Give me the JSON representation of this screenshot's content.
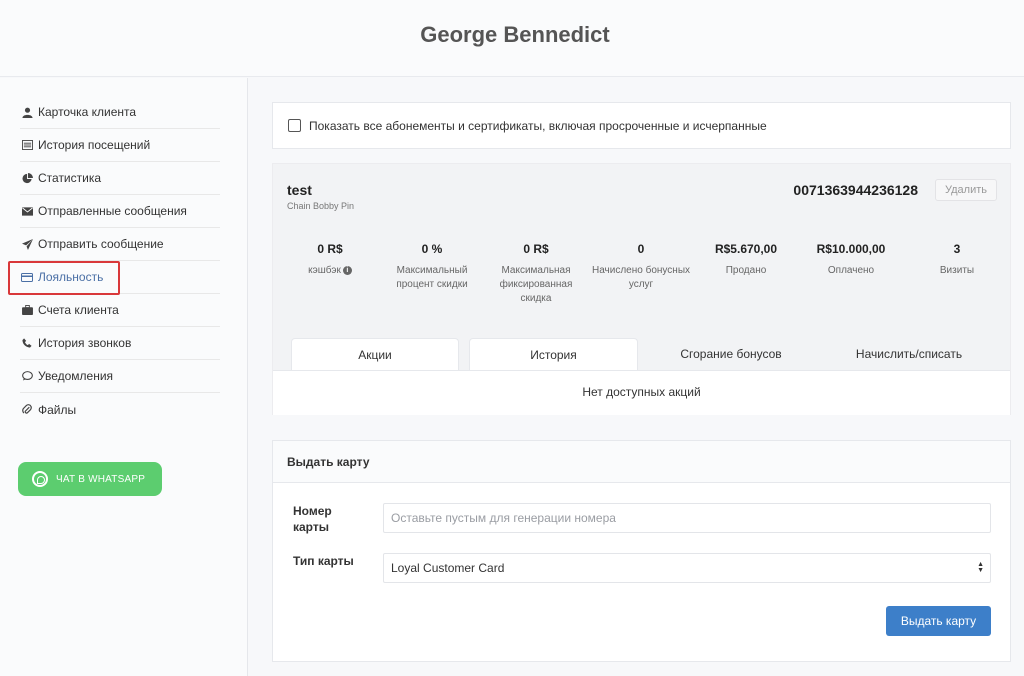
{
  "header": {
    "title": "George Bennedict"
  },
  "sidebar": {
    "items": [
      {
        "label": "Карточка клиента"
      },
      {
        "label": "История посещений"
      },
      {
        "label": "Статистика"
      },
      {
        "label": "Отправленные сообщения"
      },
      {
        "label": "Отправить сообщение"
      },
      {
        "label": "Лояльность"
      },
      {
        "label": "Счета клиента"
      },
      {
        "label": "История звонков"
      },
      {
        "label": "Уведомления"
      },
      {
        "label": "Файлы"
      }
    ],
    "whatsapp_label": "ЧАТ В WHATSAPP"
  },
  "filter": {
    "show_all_label": "Показать все абонементы и сертификаты, включая просроченные и исчерпанные"
  },
  "card": {
    "name": "test",
    "subtitle": "Chain Bobby Pin",
    "number": "0071363944236128",
    "delete_label": "Удалить",
    "stats": [
      {
        "value": "0  R$",
        "label": "кэшбэк"
      },
      {
        "value": "0 %",
        "label": "Максимальный процент скидки"
      },
      {
        "value": "0 R$",
        "label": "Максимальная фиксированная скидка"
      },
      {
        "value": "0",
        "label": "Начислено бонусных услуг"
      },
      {
        "value": "R$5.670,00",
        "label": "Продано"
      },
      {
        "value": "R$10.000,00",
        "label": "Оплачено"
      },
      {
        "value": "3",
        "label": "Визиты"
      }
    ],
    "tabs": [
      {
        "label": "Акции"
      },
      {
        "label": "История"
      },
      {
        "label": "Сгорание бонусов"
      },
      {
        "label": "Начислить/списать"
      }
    ],
    "empty_text": "Нет доступных акций"
  },
  "issue_card": {
    "title": "Выдать карту",
    "number_label": "Номер карты",
    "number_placeholder": "Оставьте пустым для генерации номера",
    "type_label": "Тип карты",
    "type_value": "Loyal Customer Card",
    "submit_label": "Выдать карту"
  }
}
